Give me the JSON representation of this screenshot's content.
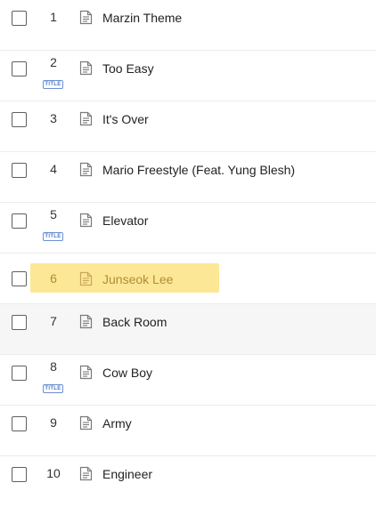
{
  "tracks": [
    {
      "num": "1",
      "title": "Marzin Theme",
      "badge": ""
    },
    {
      "num": "2",
      "title": "Too Easy",
      "badge": "TITLE"
    },
    {
      "num": "3",
      "title": "It's Over",
      "badge": ""
    },
    {
      "num": "4",
      "title": "Mario Freestyle (Feat. Yung Blesh)",
      "badge": ""
    },
    {
      "num": "5",
      "title": "Elevator",
      "badge": "TITLE"
    },
    {
      "num": "6",
      "title": "Junseok Lee",
      "badge": ""
    },
    {
      "num": "7",
      "title": "Back Room",
      "badge": ""
    },
    {
      "num": "8",
      "title": "Cow Boy",
      "badge": "TITLE"
    },
    {
      "num": "9",
      "title": "Army",
      "badge": ""
    },
    {
      "num": "10",
      "title": "Engineer",
      "badge": ""
    }
  ],
  "highlighted_index": 5,
  "hovered_index": 6,
  "colors": {
    "highlight": "#fbe796",
    "highlight_text": "#b18c36",
    "badge": "#4a74c4"
  },
  "icons": {
    "row_icon": "document-icon"
  }
}
